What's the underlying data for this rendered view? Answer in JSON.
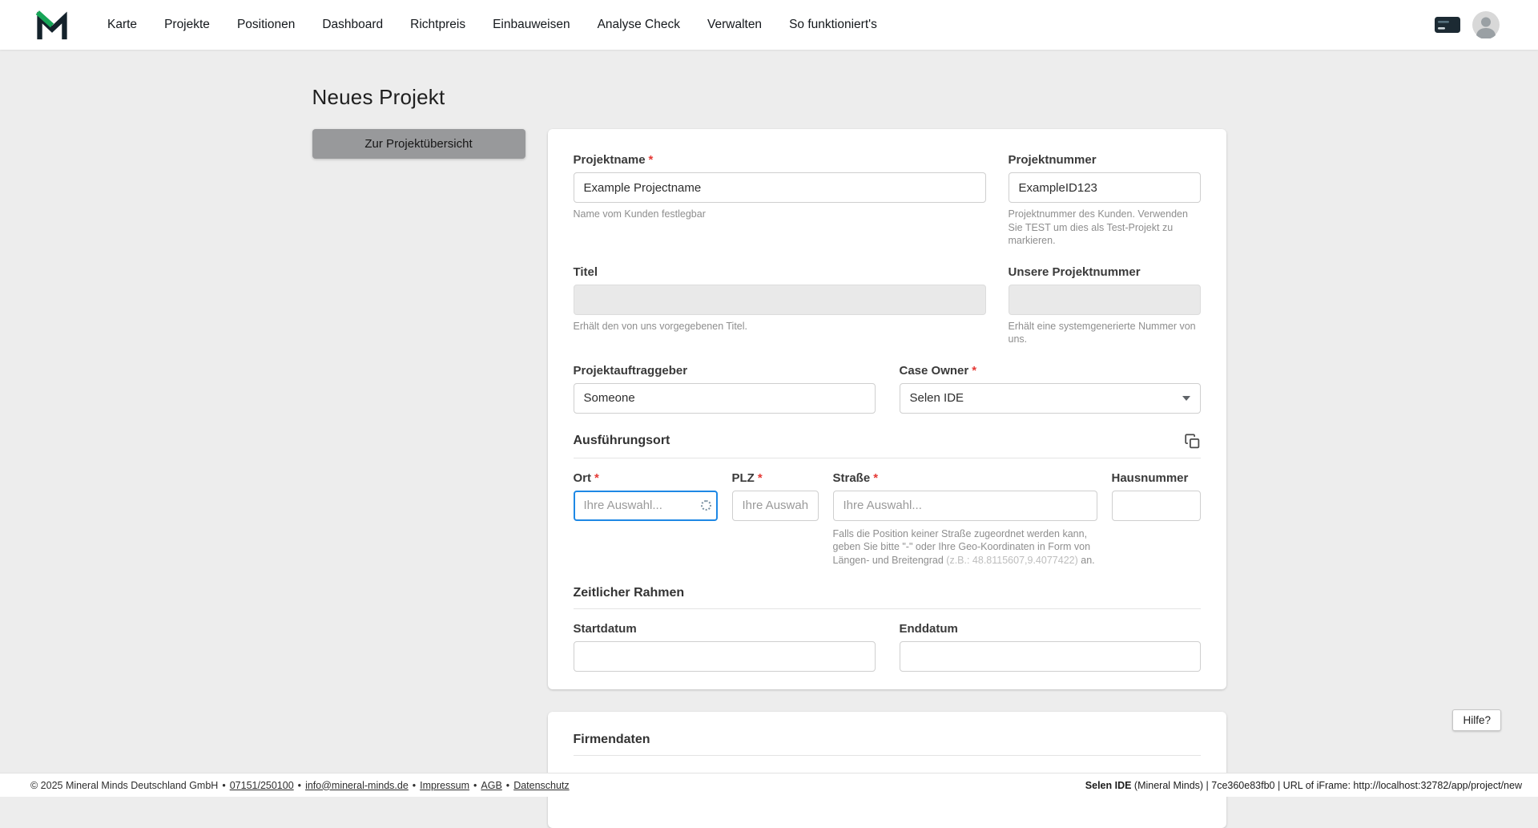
{
  "nav": {
    "items": [
      "Karte",
      "Projekte",
      "Positionen",
      "Dashboard",
      "Richtpreis",
      "Einbauweisen",
      "Analyse Check",
      "Verwalten",
      "So funktioniert's"
    ]
  },
  "page": {
    "title": "Neues Projekt",
    "overview_button": "Zur Projektübersicht"
  },
  "form": {
    "required_marker": "*",
    "projektname": {
      "label": "Projektname",
      "value": "Example Projectname",
      "helper": "Name vom Kunden festlegbar"
    },
    "projektnummer": {
      "label": "Projektnummer",
      "value": "ExampleID123",
      "helper": "Projektnummer des Kunden. Verwenden Sie TEST um dies als Test-Projekt zu markieren."
    },
    "titel": {
      "label": "Titel",
      "helper": "Erhält den von uns vorgegebenen Titel."
    },
    "unsere_projektnummer": {
      "label": "Unsere Projektnummer",
      "helper": "Erhält eine systemgenerierte Nummer von uns."
    },
    "projektauftraggeber": {
      "label": "Projektauftraggeber",
      "value": "Someone"
    },
    "case_owner": {
      "label": "Case Owner",
      "value": "Selen IDE"
    },
    "sections": {
      "ausfuehrungsort": "Ausführungsort",
      "zeitlicher_rahmen": "Zeitlicher Rahmen",
      "firmendaten": "Firmendaten"
    },
    "ort": {
      "label": "Ort",
      "placeholder": "Ihre Auswahl..."
    },
    "plz": {
      "label": "PLZ",
      "placeholder": "Ihre Auswahl."
    },
    "strasse": {
      "label": "Straße",
      "placeholder": "Ihre Auswahl...",
      "helper_main": "Falls die Position keiner Straße zugeordnet werden kann, geben Sie bitte \"-\" oder Ihre Geo-Koordinaten in Form von Längen- und Breitengrad ",
      "helper_example": "(z.B.: 48.8115607,9.4077422)",
      "helper_suffix": " an."
    },
    "hausnummer": {
      "label": "Hausnummer"
    },
    "startdatum": {
      "label": "Startdatum"
    },
    "enddatum": {
      "label": "Enddatum"
    }
  },
  "help_button": "Hilfe?",
  "footer": {
    "copyright": "© 2025 Mineral Minds Deutschland GmbH",
    "separator": "•",
    "phone": "07151/250100",
    "email": "info@mineral-minds.de",
    "impressum": "Impressum",
    "agb": "AGB",
    "datenschutz": "Datenschutz",
    "session_user": "Selen IDE",
    "session_rest": " (Mineral Minds) | 7ce360e83fb0 | URL of iFrame: http://localhost:32782/app/project/new"
  },
  "colors": {
    "brand_green": "#17a558",
    "brand_dark": "#14222b",
    "focus_blue": "#1e88e5",
    "required_red": "#e53935",
    "page_background": "#ededed",
    "button_gray": "#98999b"
  }
}
